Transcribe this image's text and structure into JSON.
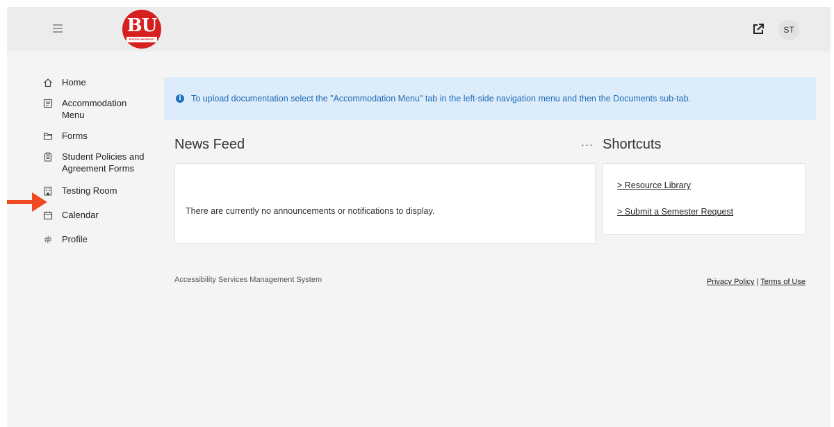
{
  "header": {
    "logo_letters": "BU",
    "logo_subtext": "BOSTON UNIVERSITY",
    "avatar_initials": "ST",
    "menu_icon": "hamburger-icon",
    "external_icon": "external-link-icon"
  },
  "sidebar": {
    "items": [
      {
        "label": "Home",
        "icon": "home-icon"
      },
      {
        "label": "Accommodation Menu",
        "icon": "accommodation-icon"
      },
      {
        "label": "Forms",
        "icon": "folder-icon"
      },
      {
        "label": "Student Policies and Agreement Forms",
        "icon": "clipboard-icon"
      },
      {
        "label": "Testing Room",
        "icon": "building-icon"
      },
      {
        "label": "Calendar",
        "icon": "calendar-icon"
      },
      {
        "label": "Profile",
        "icon": "gear-icon"
      }
    ]
  },
  "banner": {
    "text": "To upload documentation select the \"Accommodation Menu\" tab in the left-side navigation menu and then the Documents sub-tab.",
    "icon_glyph": "i"
  },
  "news": {
    "title": "News Feed",
    "more": "···",
    "empty_message": "There are currently no announcements or notifications to display."
  },
  "shortcuts": {
    "title": "Shortcuts",
    "links": [
      "> Resource Library",
      "> Submit a Semester Request"
    ]
  },
  "footer": {
    "app_name": "Accessibility Services Management System",
    "privacy": "Privacy Policy",
    "separator": " | ",
    "terms": "Terms of Use"
  },
  "colors": {
    "brand_red": "#d5201f",
    "banner_bg": "#dcecfa",
    "banner_text": "#1e6bb8",
    "arrow": "#ef4a23"
  }
}
